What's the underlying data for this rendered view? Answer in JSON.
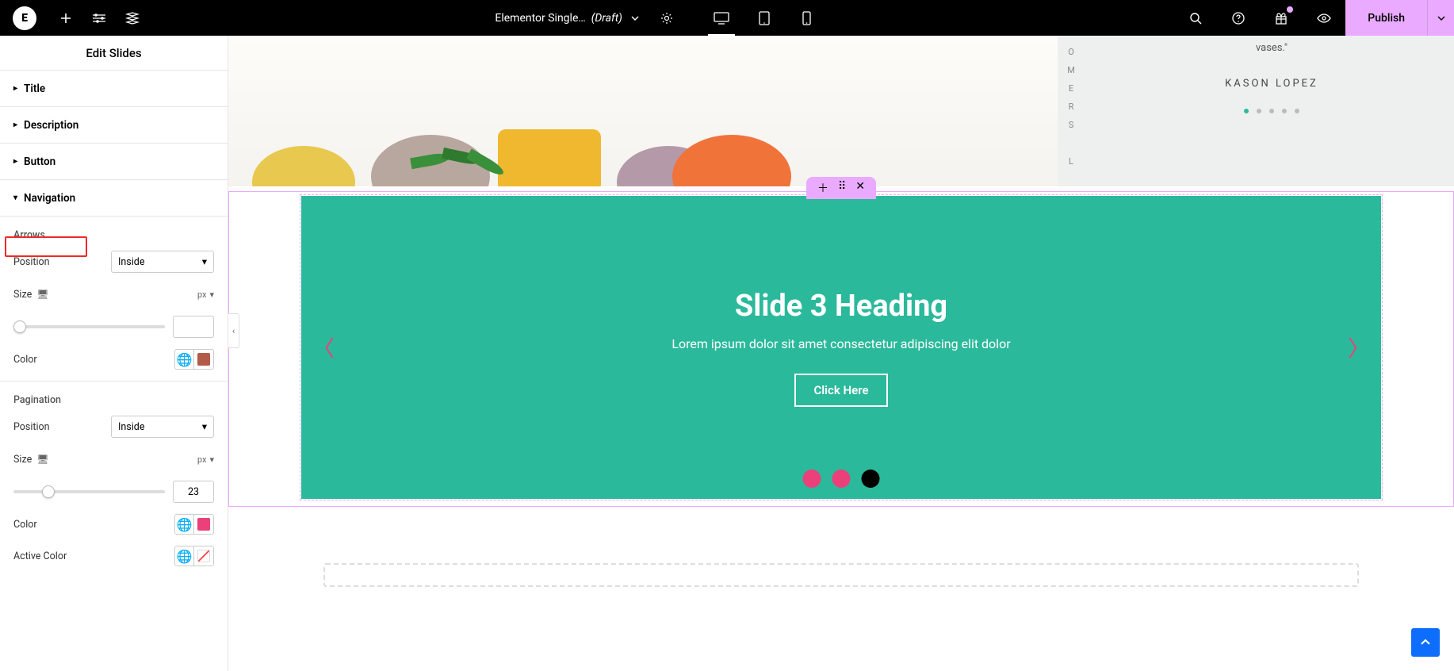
{
  "topbar": {
    "logo_text": "E",
    "doc_title": "Elementor Single…",
    "doc_status": "(Draft)",
    "publish_label": "Publish"
  },
  "sidebar": {
    "header": "Edit Slides",
    "sections": {
      "title": "Title",
      "description": "Description",
      "button": "Button",
      "navigation": "Navigation"
    },
    "arrows": {
      "heading": "Arrows",
      "position_label": "Position",
      "position_value": "Inside",
      "size_label": "Size",
      "size_unit": "px",
      "size_value": "",
      "color_label": "Color",
      "color_value": "#b35a4a"
    },
    "pagination": {
      "heading": "Pagination",
      "position_label": "Position",
      "position_value": "Inside",
      "size_label": "Size",
      "size_unit": "px",
      "size_value": "23",
      "color_label": "Color",
      "color_value": "#ec407a",
      "active_color_label": "Active Color",
      "active_color_value": "transparent"
    }
  },
  "slide": {
    "heading": "Slide 3 Heading",
    "text": "Lorem ipsum dolor sit amet consectetur adipiscing elit dolor",
    "cta": "Click Here"
  },
  "testimonial": {
    "quote": "vases.\"",
    "author": "KASON LOPEZ",
    "vertical_letters": [
      "O",
      "M",
      "E",
      "R",
      "S",
      "",
      "L"
    ]
  },
  "colors": {
    "accent": "#e9aaff",
    "slide_bg": "#2bb99b",
    "dot": "#ec407a",
    "arrow": "#ec407a"
  }
}
